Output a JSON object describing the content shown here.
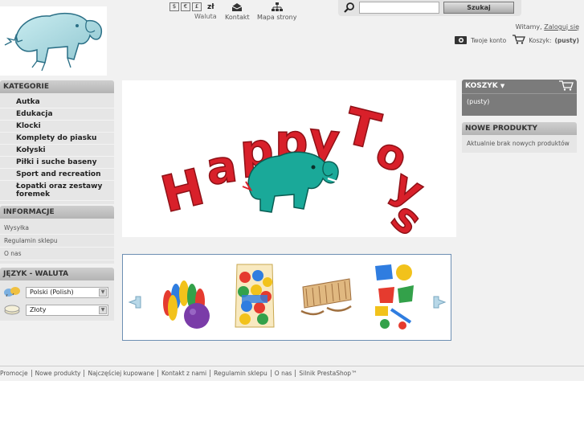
{
  "header": {
    "currency_buttons": [
      "$",
      "€",
      "£"
    ],
    "currency_selected": "zł",
    "currency_label": "Waluta",
    "contact_label": "Kontakt",
    "sitemap_label": "Mapa strony",
    "search_placeholder": "",
    "search_button": "Szukaj",
    "welcome_text": "Witamy,",
    "login_link": "Zaloguj się",
    "account_link": "Twoje konto",
    "cart_label": "Koszyk:",
    "cart_status": "(pusty)"
  },
  "categories": {
    "title": "Kategorie",
    "items": [
      "Autka",
      "Edukacja",
      "Klocki",
      "Komplety do piasku",
      "Kołyski",
      "Piłki i suche baseny",
      "Sport and recreation",
      "Łopatki oraz zestawy foremek"
    ]
  },
  "info": {
    "title": "Informacje",
    "items": [
      "Wysyłka",
      "Regulamin sklepu",
      "O nas"
    ]
  },
  "lang": {
    "title": "Język - Waluta",
    "language_value": "Polski (Polish)",
    "currency_value": "Złoty"
  },
  "cart": {
    "title": "Koszyk",
    "status": "(pusty)"
  },
  "new_products": {
    "title": "Nowe produkty",
    "message": "Aktualnie brak nowych produktów"
  },
  "banner": {
    "logo_text": "Happy Toys"
  },
  "footer": {
    "links": [
      "Promocje",
      "Nowe produkty",
      "Najczęściej kupowane",
      "Kontakt z nami",
      "Regulamin sklepu",
      "O nas",
      "Silnik PrestaShop™"
    ]
  },
  "colors": {
    "banner_red": "#d8202a",
    "elephant_teal": "#1aa999",
    "cart_bg": "#7b7b7b",
    "carousel_border": "#6d8fb3"
  }
}
